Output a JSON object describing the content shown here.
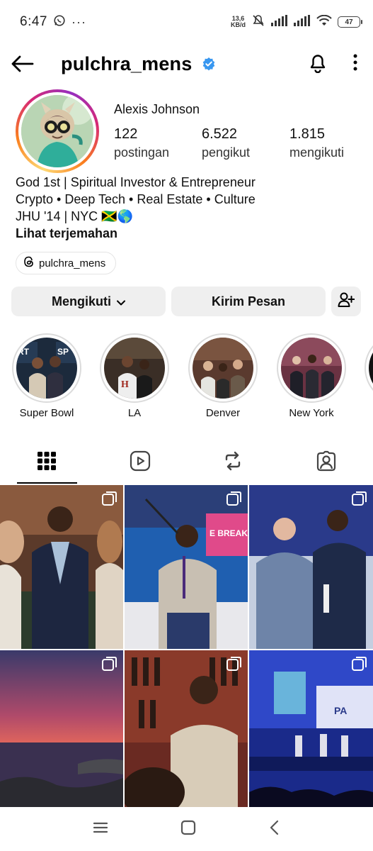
{
  "status_bar": {
    "time": "6:47",
    "netspeed_value": "13,6",
    "netspeed_unit": "KB/d",
    "battery": "47"
  },
  "header": {
    "username": "pulchra_mens",
    "verified": true
  },
  "profile": {
    "display_name": "Alexis Johnson",
    "stats": [
      {
        "value": "122",
        "label": "postingan"
      },
      {
        "value": "6.522",
        "label": "pengikut"
      },
      {
        "value": "1.815",
        "label": "mengikuti"
      }
    ],
    "bio_lines": [
      "God 1st | Spiritual Investor & Entrepreneur",
      "Crypto • Deep Tech • Real Estate • Culture",
      "JHU '14 | NYC 🇯🇲🌎"
    ],
    "see_translation": "Lihat terjemahan",
    "threads_handle": "pulchra_mens"
  },
  "actions": {
    "follow_label": "Mengikuti",
    "message_label": "Kirim Pesan"
  },
  "highlights": [
    {
      "label": "Super Bowl"
    },
    {
      "label": "LA"
    },
    {
      "label": "Denver"
    },
    {
      "label": "New York"
    }
  ],
  "tabs": [
    "grid-icon",
    "reels-icon",
    "reposts-icon",
    "tagged-icon"
  ],
  "colors": {
    "verified_blue": "#3897f0",
    "button_gray": "#efefef",
    "ring_gradient": [
      "#feda75",
      "#fa7e1e",
      "#d62976",
      "#962fbf"
    ]
  }
}
